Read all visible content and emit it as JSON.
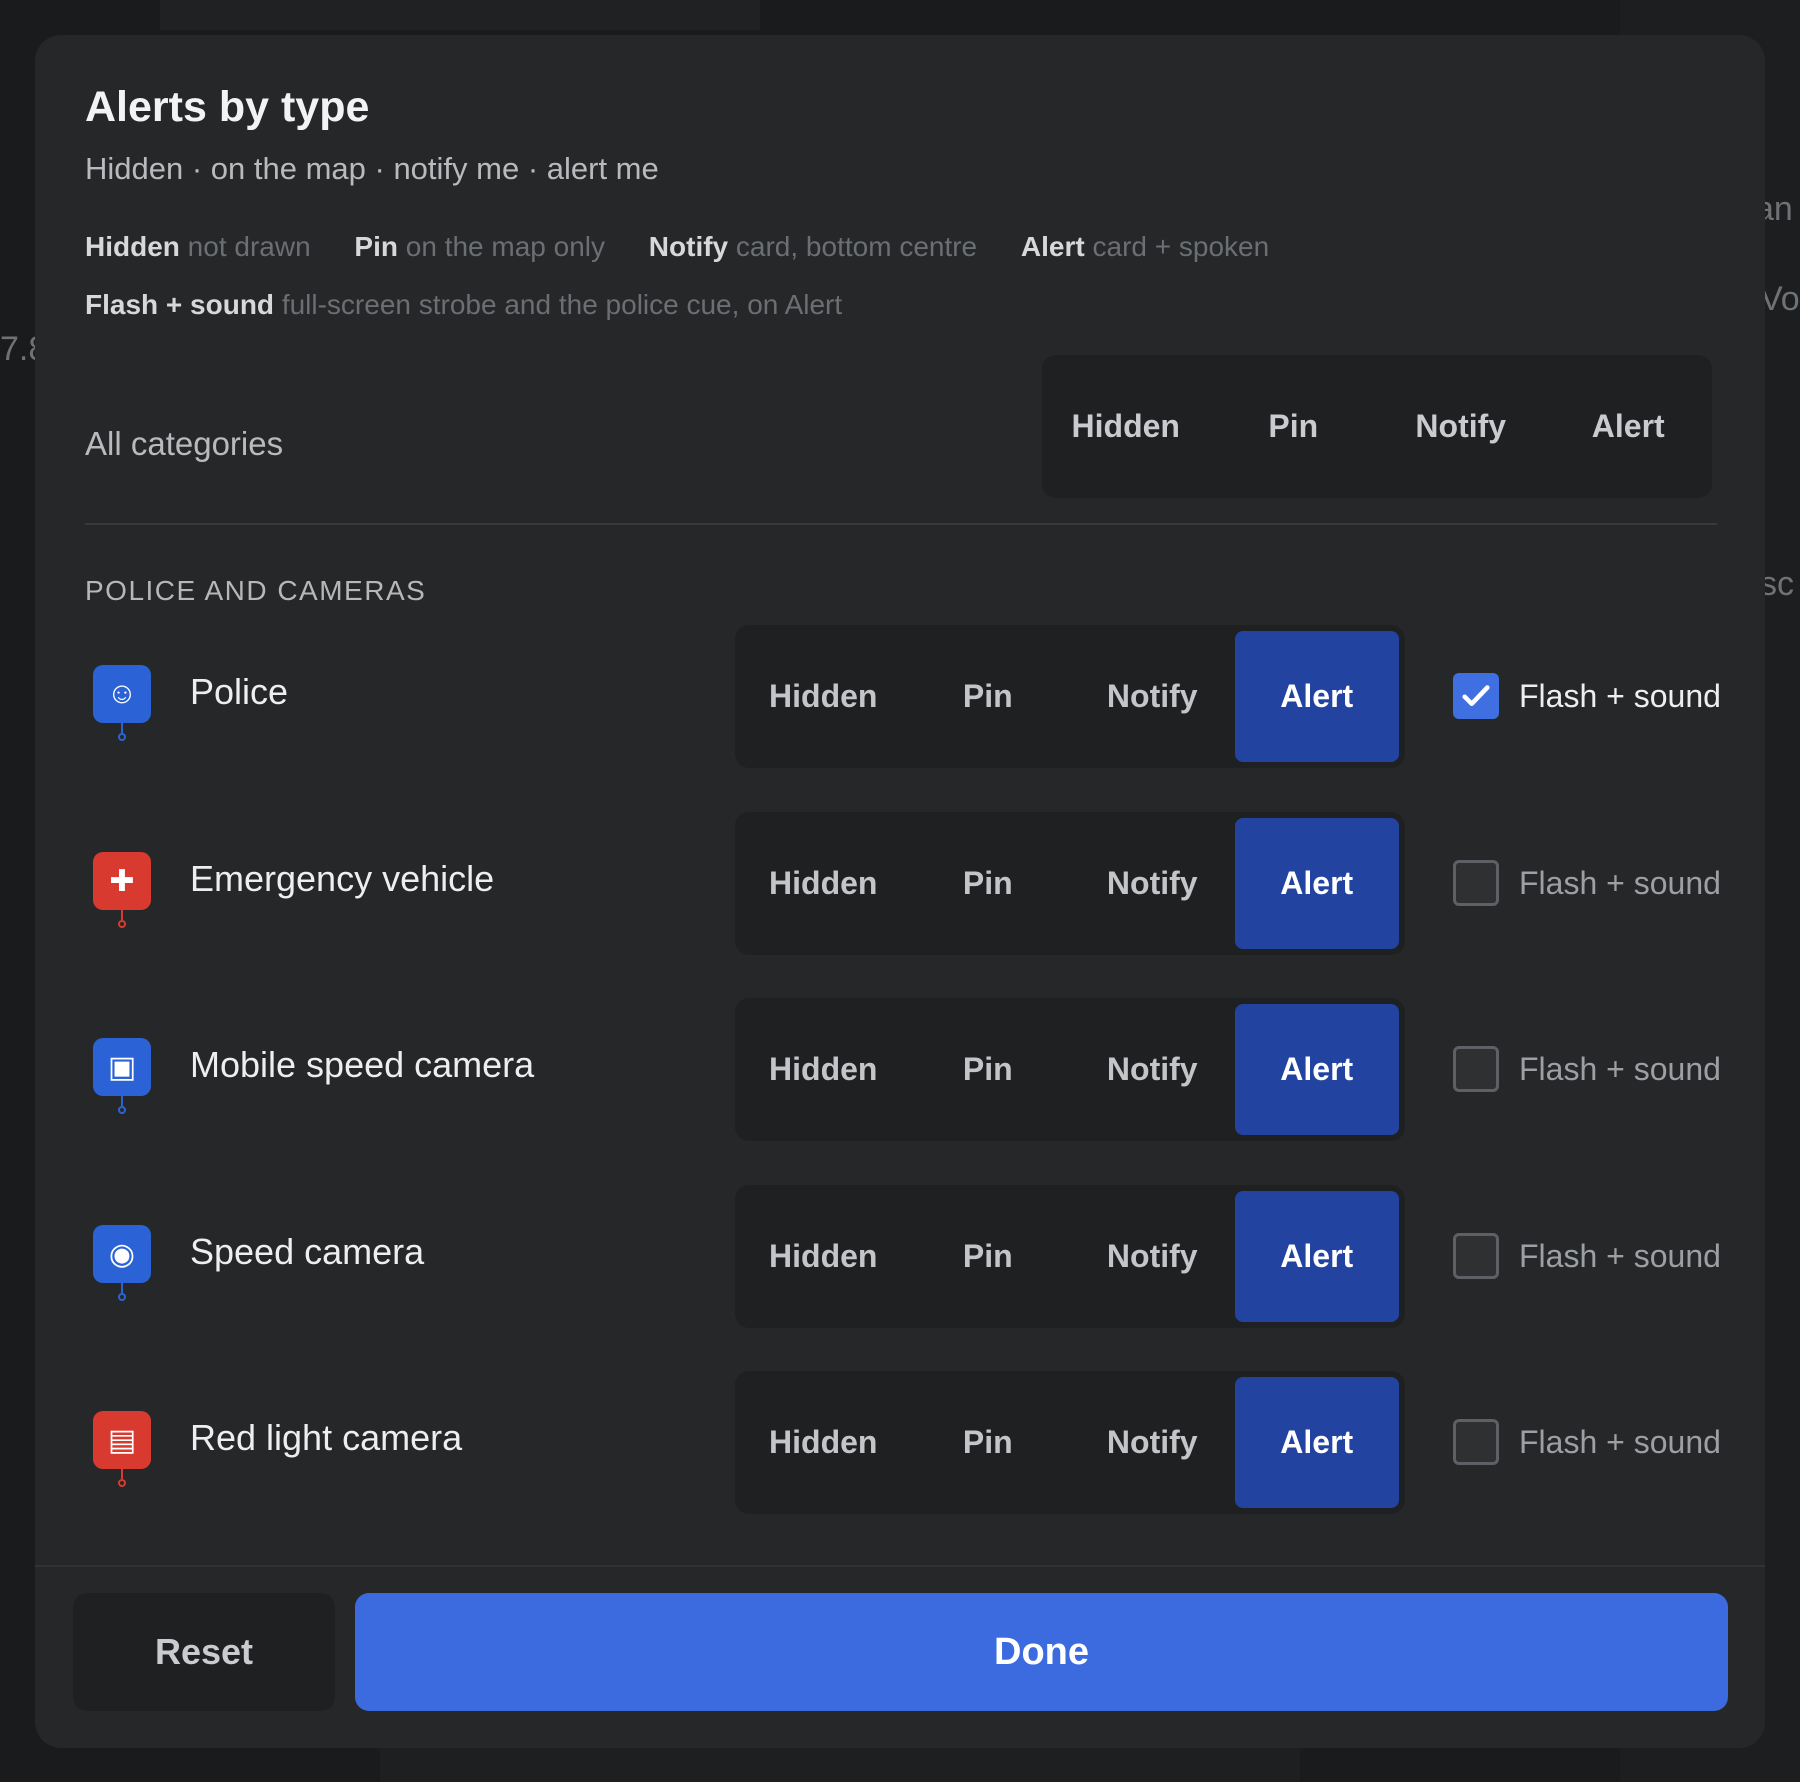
{
  "dialog": {
    "title": "Alerts by type",
    "subtitle": "Hidden · on the map · notify me · alert me",
    "legend": [
      {
        "key": "Hidden",
        "desc": "not drawn"
      },
      {
        "key": "Pin",
        "desc": "on the map only"
      },
      {
        "key": "Notify",
        "desc": "card, bottom centre"
      },
      {
        "key": "Alert",
        "desc": "card + spoken"
      },
      {
        "key": "Flash + sound",
        "desc": "full-screen strobe and the police cue, on Alert"
      }
    ],
    "all_categories": {
      "label": "All categories",
      "options": [
        "Hidden",
        "Pin",
        "Notify",
        "Alert"
      ]
    },
    "section_title": "POLICE AND CAMERAS",
    "options": [
      "Hidden",
      "Pin",
      "Notify",
      "Alert"
    ],
    "flash_label": "Flash + sound",
    "rows": [
      {
        "name": "Police",
        "icon": "police-officer-icon",
        "icon_color": "#2b63d6",
        "selected": "Alert",
        "flash": true
      },
      {
        "name": "Emergency vehicle",
        "icon": "ambulance-icon",
        "icon_color": "#d93a30",
        "selected": "Alert",
        "flash": false
      },
      {
        "name": "Mobile speed camera",
        "icon": "tripod-camera-icon",
        "icon_color": "#2b63d6",
        "selected": "Alert",
        "flash": false
      },
      {
        "name": "Speed camera",
        "icon": "speed-camera-icon",
        "icon_color": "#2b63d6",
        "selected": "Alert",
        "flash": false
      },
      {
        "name": "Red light camera",
        "icon": "traffic-light-camera-icon",
        "icon_color": "#d93a30",
        "selected": "Alert",
        "flash": false
      }
    ],
    "footer": {
      "reset_label": "Reset",
      "done_label": "Done"
    }
  },
  "colors": {
    "accent": "#3c6be0",
    "selected_segment": "#2244a0",
    "dialog_bg": "#262728"
  }
}
